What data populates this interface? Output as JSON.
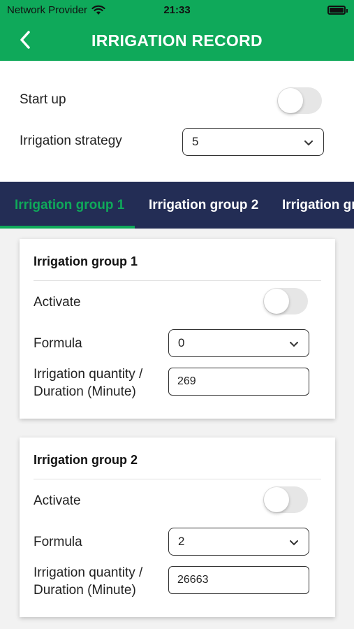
{
  "status_bar": {
    "carrier": "Network Provider",
    "time": "21:33"
  },
  "header": {
    "title": "IRRIGATION RECORD"
  },
  "settings": {
    "startup_label": "Start up",
    "startup_on": false,
    "strategy_label": "Irrigation strategy",
    "strategy_value": "5"
  },
  "tabs": [
    {
      "label": "Irrigation group 1",
      "active": true
    },
    {
      "label": "Irrigation group 2",
      "active": false
    },
    {
      "label": "Irrigation gr",
      "active": false
    }
  ],
  "groups": [
    {
      "title": "Irrigation group 1",
      "activate_label": "Activate",
      "activate_on": false,
      "formula_label": "Formula",
      "formula_value": "0",
      "quantity_label_line1": "Irrigation quantity /",
      "quantity_label_line2": "Duration (Minute)",
      "quantity_value": "269"
    },
    {
      "title": "Irrigation group 2",
      "activate_label": "Activate",
      "activate_on": false,
      "formula_label": "Formula",
      "formula_value": "2",
      "quantity_label_line1": "Irrigation quantity /",
      "quantity_label_line2": "Duration (Minute)",
      "quantity_value": "26663"
    }
  ],
  "colors": {
    "primary": "#0fa95a",
    "tab_bar": "#232d55",
    "background": "#f2f2f2"
  },
  "icons": {
    "back": "chevron-left-icon",
    "dropdown": "chevron-down-icon",
    "wifi": "wifi-icon",
    "battery": "battery-icon"
  }
}
